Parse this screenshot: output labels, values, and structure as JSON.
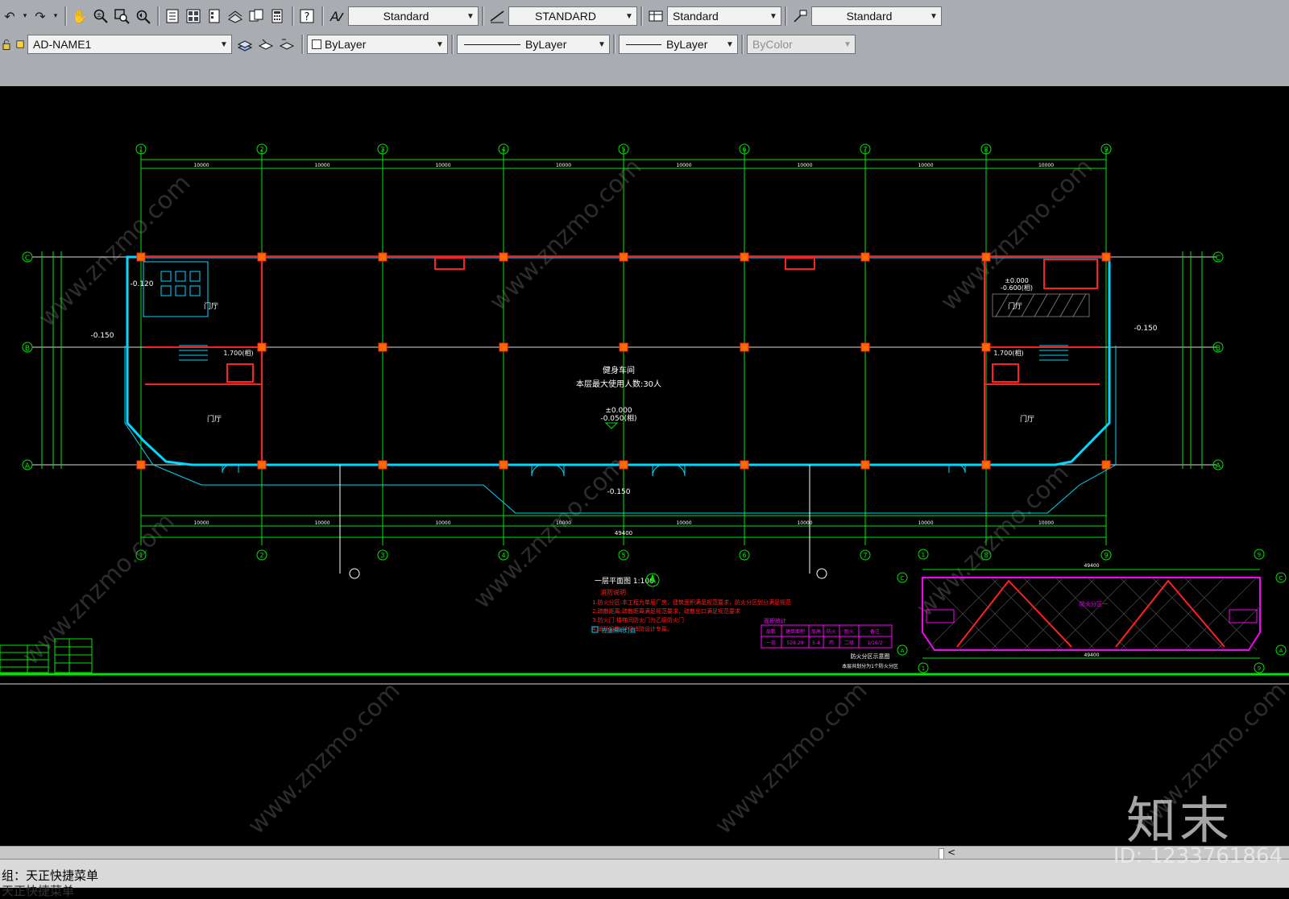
{
  "toolbar": {
    "text_style": "Standard",
    "dim_style": "STANDARD",
    "table_style": "Standard",
    "multileader_style": "Standard",
    "layer": "AD-NAME1",
    "color": "ByLayer",
    "linetype": "ByLayer",
    "lineweight": "ByLayer",
    "plot_style": "ByColor"
  },
  "drawing": {
    "grid_numbers": [
      "1",
      "2",
      "3",
      "4",
      "5",
      "6",
      "7",
      "8",
      "9"
    ],
    "grid_letters": [
      "C",
      "B",
      "A"
    ],
    "room_center": "健身车间",
    "occupancy_note": "本层最大使用人数:30人",
    "level_main": "±0.000",
    "level_main_sub": "-0.050(相)",
    "level_outdoor": "-0.150",
    "level_minus120": "-0.120",
    "level_left_hall": "门厅",
    "level_right_hall": "门厅",
    "level_stair": "1.700(相)",
    "level_right_top": "±0.000",
    "level_right_top_sub": "-0.600(相)",
    "total_dim": "49400",
    "span_dims": [
      "10000",
      "10000",
      "10000",
      "10000",
      "10000",
      "10000",
      "10000",
      "10000"
    ],
    "plan_title": "一层平面图 1:100",
    "notes_header": "消防说明",
    "notes": [
      "1.防火分区:本工程为单层厂房，建筑面积满足规范要求，防火分区划分满足规范",
      "2.疏散距离:疏散距离满足规范要求，疏散出口满足规范要求",
      "3.防火门:楼梯间防火门为乙级防火门",
      "4.消防设施:详见消防设计专篇。"
    ],
    "legend_label": "应急照明灯具",
    "table_title": "面积统计",
    "table_headers": [
      "层数",
      "建筑面积",
      "层高",
      "防火",
      "耐火",
      "备注"
    ],
    "table_row": [
      "一层",
      "528.29",
      "5.4",
      "丙",
      "二级",
      "1/16/2"
    ],
    "fire_title": "防火分区示意图",
    "fire_sub": "本层共划分为1个防火分区",
    "fire_zone_label": "防火分区一",
    "fire_dim": "49400"
  },
  "status": {
    "command_line_1": "组：天正快捷菜单",
    "command_line_2": "天正快捷菜单"
  },
  "watermark": {
    "logo": "知末",
    "id": "ID: 1233761864",
    "site": "www.znzmo.com"
  },
  "colors": {
    "toolbar_bg": "#a9acb1",
    "canvas_bg": "#000000",
    "grid_green": "#00e600",
    "wall_red": "#ff2020",
    "column_orange": "#ff6a00",
    "outline_cyan": "#00d8ff",
    "hatch_magenta": "#ff00ff"
  }
}
